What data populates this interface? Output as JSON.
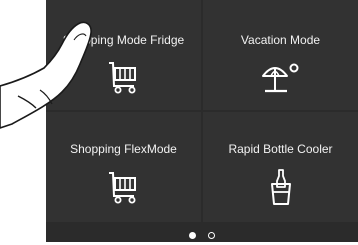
{
  "tiles": [
    {
      "label": "Shopping Mode Fridge",
      "icon": "shopping-cart-icon"
    },
    {
      "label": "Vacation Mode",
      "icon": "beach-umbrella-sun-icon"
    },
    {
      "label": "Shopping FlexMode",
      "icon": "shopping-cart-icon"
    },
    {
      "label": "Rapid Bottle Cooler",
      "icon": "bottle-cooler-icon"
    }
  ],
  "pagination": {
    "pages": 2,
    "current": 1
  },
  "colors": {
    "background": "#2b2b2b",
    "tile": "#323232",
    "text": "#f2f2f2"
  }
}
